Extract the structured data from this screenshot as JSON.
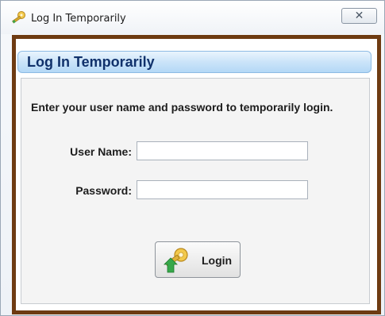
{
  "window": {
    "title": "Log In Temporarily",
    "close_glyph": "✕",
    "icons": {
      "app": "key-icon",
      "close": "close-icon"
    }
  },
  "dialog": {
    "header": "Log In Temporarily",
    "instruction": "Enter your user name and password to temporarily login.",
    "fields": {
      "username": {
        "label": "User Name:",
        "value": ""
      },
      "password": {
        "label": "Password:",
        "value": ""
      }
    },
    "login_button": {
      "label": "Login",
      "icon": "key-icon"
    }
  },
  "colors": {
    "frame": "#6e3b12",
    "header_text": "#10316b",
    "header_band": "#cbe4f9"
  }
}
